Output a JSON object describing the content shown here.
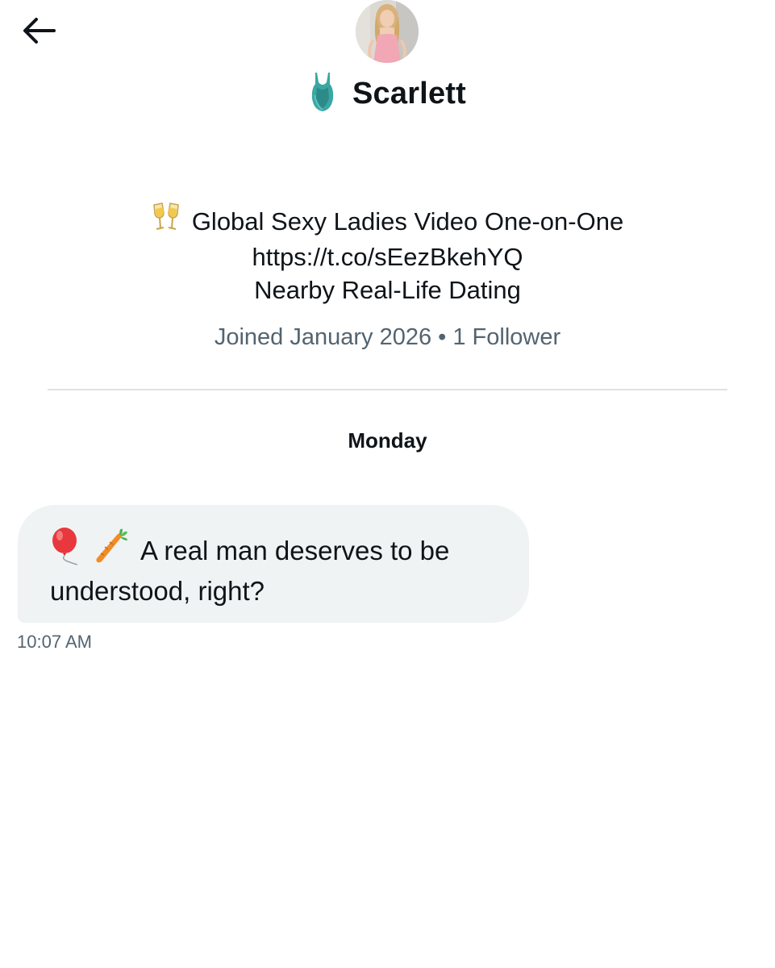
{
  "header": {
    "back_icon": "arrow-left-icon",
    "display_name": "Scarlett",
    "name_icon": "swimsuit-emoji-icon"
  },
  "profile": {
    "bio_icon": "champagne-clink-emoji-icon",
    "bio_line1": "Global Sexy Ladies Video One-on-One",
    "bio_line2": "https://t.co/sEezBkehYQ",
    "bio_line3": "Nearby Real-Life Dating",
    "meta": "Joined January 2026 • 1 Follower"
  },
  "conversation": {
    "day_label": "Monday",
    "messages": [
      {
        "icons": [
          "balloon-emoji-icon",
          "carrot-emoji-icon"
        ],
        "text_line1": "A real man deserves to be",
        "text_line2": "understood, right?",
        "time": "10:07 AM"
      }
    ]
  },
  "colors": {
    "text_primary": "#0f1419",
    "text_secondary": "#536471",
    "bubble_bg": "#eff3f4",
    "divider": "#dfe3e6"
  }
}
